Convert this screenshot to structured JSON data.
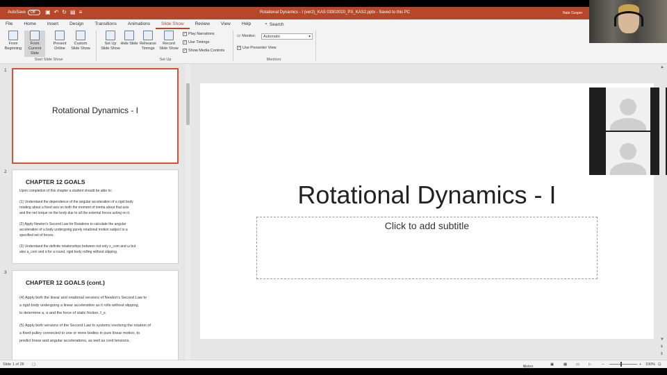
{
  "titlebar": {
    "autosave": "AutoSave",
    "toggle": "Off",
    "doc_title": "Rotational Dynamics - I (ver2)_KAS 03302020_PS_KAS2.pptx  -  Saved to this PC",
    "user": "Nate Cooper"
  },
  "tabs": [
    "File",
    "Home",
    "Insert",
    "Design",
    "Transitions",
    "Animations",
    "Slide Show",
    "Review",
    "View",
    "Help"
  ],
  "search_label": "Search",
  "ribbon": {
    "from_beginning": "From Beginning",
    "from_current": "From Current Slide",
    "present_online": "Present Online",
    "custom_show": "Custom Slide Show",
    "group_start": "Start Slide Show",
    "set_up": "Set Up Slide Show",
    "hide_slide": "Hide Slide",
    "rehearse": "Rehearse Timings",
    "record": "Record Slide Show",
    "play_narrations": "Play Narrations",
    "use_timings": "Use Timings",
    "show_media": "Show Media Controls",
    "group_setup": "Set Up",
    "monitor_label": "Monitor:",
    "monitor_value": "Automatic",
    "presenter_view": "Use Presenter View",
    "group_monitors": "Monitors"
  },
  "thumbs": {
    "n1": "1",
    "n2": "2",
    "n3": "3",
    "s1_title": "Rotational Dynamics - I",
    "s2_title": "CHAPTER 12 GOALS",
    "s2_intro": "Upon completion of this chapter a student should be able to:",
    "s2_p1a": "(1)  Understand the dependence of the angular acceleration of a rigid body",
    "s2_p1b": "      rotating about a fixed axis on both the moment of inertia about that axis",
    "s2_p1c": "      and the net torque on the body due to all the external forces acting on it.",
    "s2_p2a": "(2) Apply Newton's Second Law for Rotations to calculate the angular",
    "s2_p2b": "      acceleration of a body undergoing purely rotational motion subject to a",
    "s2_p2c": "      specified set of forces.",
    "s2_p3a": "(3) Understand the definite relationships between not only x_com and ω but",
    "s2_p3b": "      also a_com and α for a round, rigid body rolling without slipping.",
    "s3_title": "CHAPTER 12 GOALS (cont.)",
    "s3_p4a": "(4) Apply both the linear and rotational versions of Newton's Second Law to",
    "s3_p4b": "      a rigid body undergoing a linear acceleration as it rolls without slipping,",
    "s3_p4c": "      to determine a, α and the force of static friction, f_s.",
    "s3_p5a": "(5) Apply both versions of the Second Law to systems involving the rotation of",
    "s3_p5b": "      a fixed pulley connected to one or more bodies in pure linear motion, to",
    "s3_p5c": "      predict linear and angular accelerations, as well as cord tensions."
  },
  "slide": {
    "title": "Rotational Dynamics - I",
    "subtitle_placeholder": "Click to add subtitle"
  },
  "status": {
    "slide_of": "Slide 1 of 28",
    "notes": "Notes",
    "zoom": "100%"
  }
}
